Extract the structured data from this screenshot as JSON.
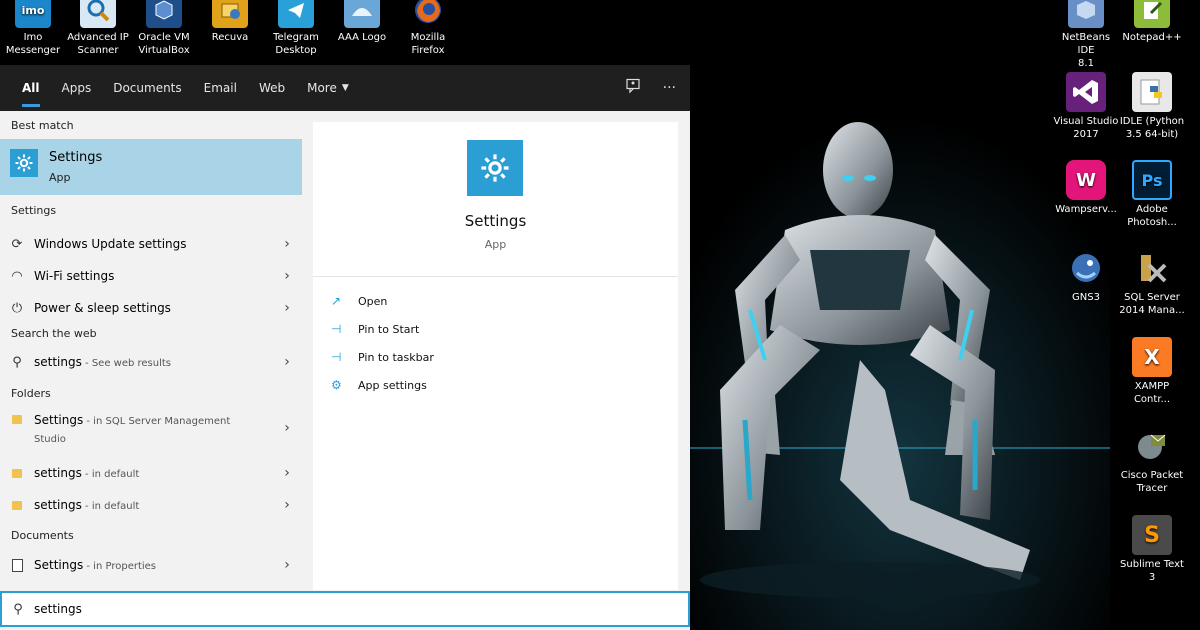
{
  "desktop": {
    "top_icons": [
      {
        "line1": "Imo",
        "line2": "Messenger",
        "icon": "imo-icon",
        "badge": "imo",
        "color": "#1b86c9"
      },
      {
        "line1": "Advanced IP",
        "line2": "Scanner",
        "icon": "advanced-ip-scanner-icon",
        "badge": "",
        "color": "#d9e8f5"
      },
      {
        "line1": "Oracle VM",
        "line2": "VirtualBox",
        "icon": "virtualbox-icon",
        "badge": "",
        "color": "#1f4f8a"
      },
      {
        "line1": "Recuva",
        "line2": "",
        "icon": "recuva-icon",
        "badge": "",
        "color": "#e0a21b"
      },
      {
        "line1": "Telegram",
        "line2": "Desktop",
        "icon": "telegram-icon",
        "badge": "",
        "color": "#2aa0d8"
      },
      {
        "line1": "AAA Logo",
        "line2": "",
        "icon": "aaa-logo-icon",
        "badge": "",
        "color": "#6aa7d8"
      },
      {
        "line1": "Mozilla",
        "line2": "Firefox",
        "icon": "firefox-icon",
        "badge": "",
        "color": "#e46b1c"
      }
    ],
    "right_icons": [
      {
        "line1": "NetBeans IDE",
        "line2": "8.1",
        "icon": "netbeans-icon",
        "badge": "",
        "color": "#6a8fc7"
      },
      {
        "line1": "Notepad++",
        "line2": "",
        "icon": "notepad-plus-plus-icon",
        "badge": "",
        "color": "#8dbb3a"
      },
      {
        "line1": "Visual Studio",
        "line2": "2017",
        "icon": "visual-studio-icon",
        "badge": "VS",
        "color": "#68217a"
      },
      {
        "line1": "IDLE (Python",
        "line2": "3.5 64-bit)",
        "icon": "python-idle-icon",
        "badge": "",
        "color": "#e8e8e8"
      },
      {
        "line1": "Wampserv...",
        "line2": "",
        "icon": "wampserver-icon",
        "badge": "W",
        "color": "#e3157a"
      },
      {
        "line1": "Adobe",
        "line2": "Photosh...",
        "icon": "photoshop-icon",
        "badge": "Ps",
        "color": "#001d34"
      },
      {
        "line1": "GNS3",
        "line2": "",
        "icon": "gns3-icon",
        "badge": "",
        "color": "#3b6fb6"
      },
      {
        "line1": "SQL Server",
        "line2": "2014 Mana...",
        "icon": "sql-server-icon",
        "badge": "",
        "color": "#c8a24a"
      },
      {
        "line1": "XAMPP",
        "line2": "Contr...",
        "icon": "xampp-icon",
        "badge": "X",
        "color": "#fb7a24"
      },
      {
        "line1": "Cisco Packet",
        "line2": "Tracer",
        "icon": "cisco-packet-tracer-icon",
        "badge": "",
        "color": "#7f8c3a"
      },
      {
        "line1": "Sublime Text",
        "line2": "3",
        "icon": "sublime-text-icon",
        "badge": "S",
        "color": "#4a4a4a"
      }
    ]
  },
  "search": {
    "tabs": [
      {
        "label": "All",
        "active": true
      },
      {
        "label": "Apps"
      },
      {
        "label": "Documents"
      },
      {
        "label": "Email"
      },
      {
        "label": "Web"
      },
      {
        "label": "More"
      }
    ],
    "feedback_icon": "feedback-icon",
    "more_options": "···",
    "best_match": {
      "header": "Best match",
      "title": "Settings",
      "subtitle": "App"
    },
    "settings_section": {
      "header": "Settings",
      "items": [
        {
          "icon": "windows-update-icon",
          "glyph": "⟳",
          "text": "Windows Update",
          "bold": "settings"
        },
        {
          "icon": "wifi-icon",
          "glyph": "◠",
          "text": "Wi-Fi",
          "bold": "settings"
        },
        {
          "icon": "power-icon",
          "glyph": "⏻",
          "text": "Power & sleep",
          "bold": "settings"
        }
      ]
    },
    "web_section": {
      "header": "Search the web",
      "item": {
        "bold": "settings",
        "sub": " - See web results"
      }
    },
    "folders_section": {
      "header": "Folders",
      "items": [
        {
          "bold": "Settings",
          "sub": " - in SQL Server Management",
          "sub2": "Studio"
        },
        {
          "bold": "settings",
          "sub": " - in default",
          "sub2": ""
        },
        {
          "bold": "settings",
          "sub": " - in default",
          "sub2": ""
        }
      ]
    },
    "documents_section": {
      "header": "Documents",
      "item": {
        "bold": "Settings",
        "sub": " - in Properties"
      }
    },
    "preview": {
      "title": "Settings",
      "subtitle": "App",
      "actions": [
        {
          "label": "Open",
          "glyph": "↗"
        },
        {
          "label": "Pin to Start",
          "glyph": "⊣"
        },
        {
          "label": "Pin to taskbar",
          "glyph": "⊣"
        },
        {
          "label": "App settings",
          "glyph": "⚙"
        }
      ]
    },
    "query": "settings",
    "accent": "#2b9fd3",
    "selected_bg": "#a9d3e6"
  }
}
